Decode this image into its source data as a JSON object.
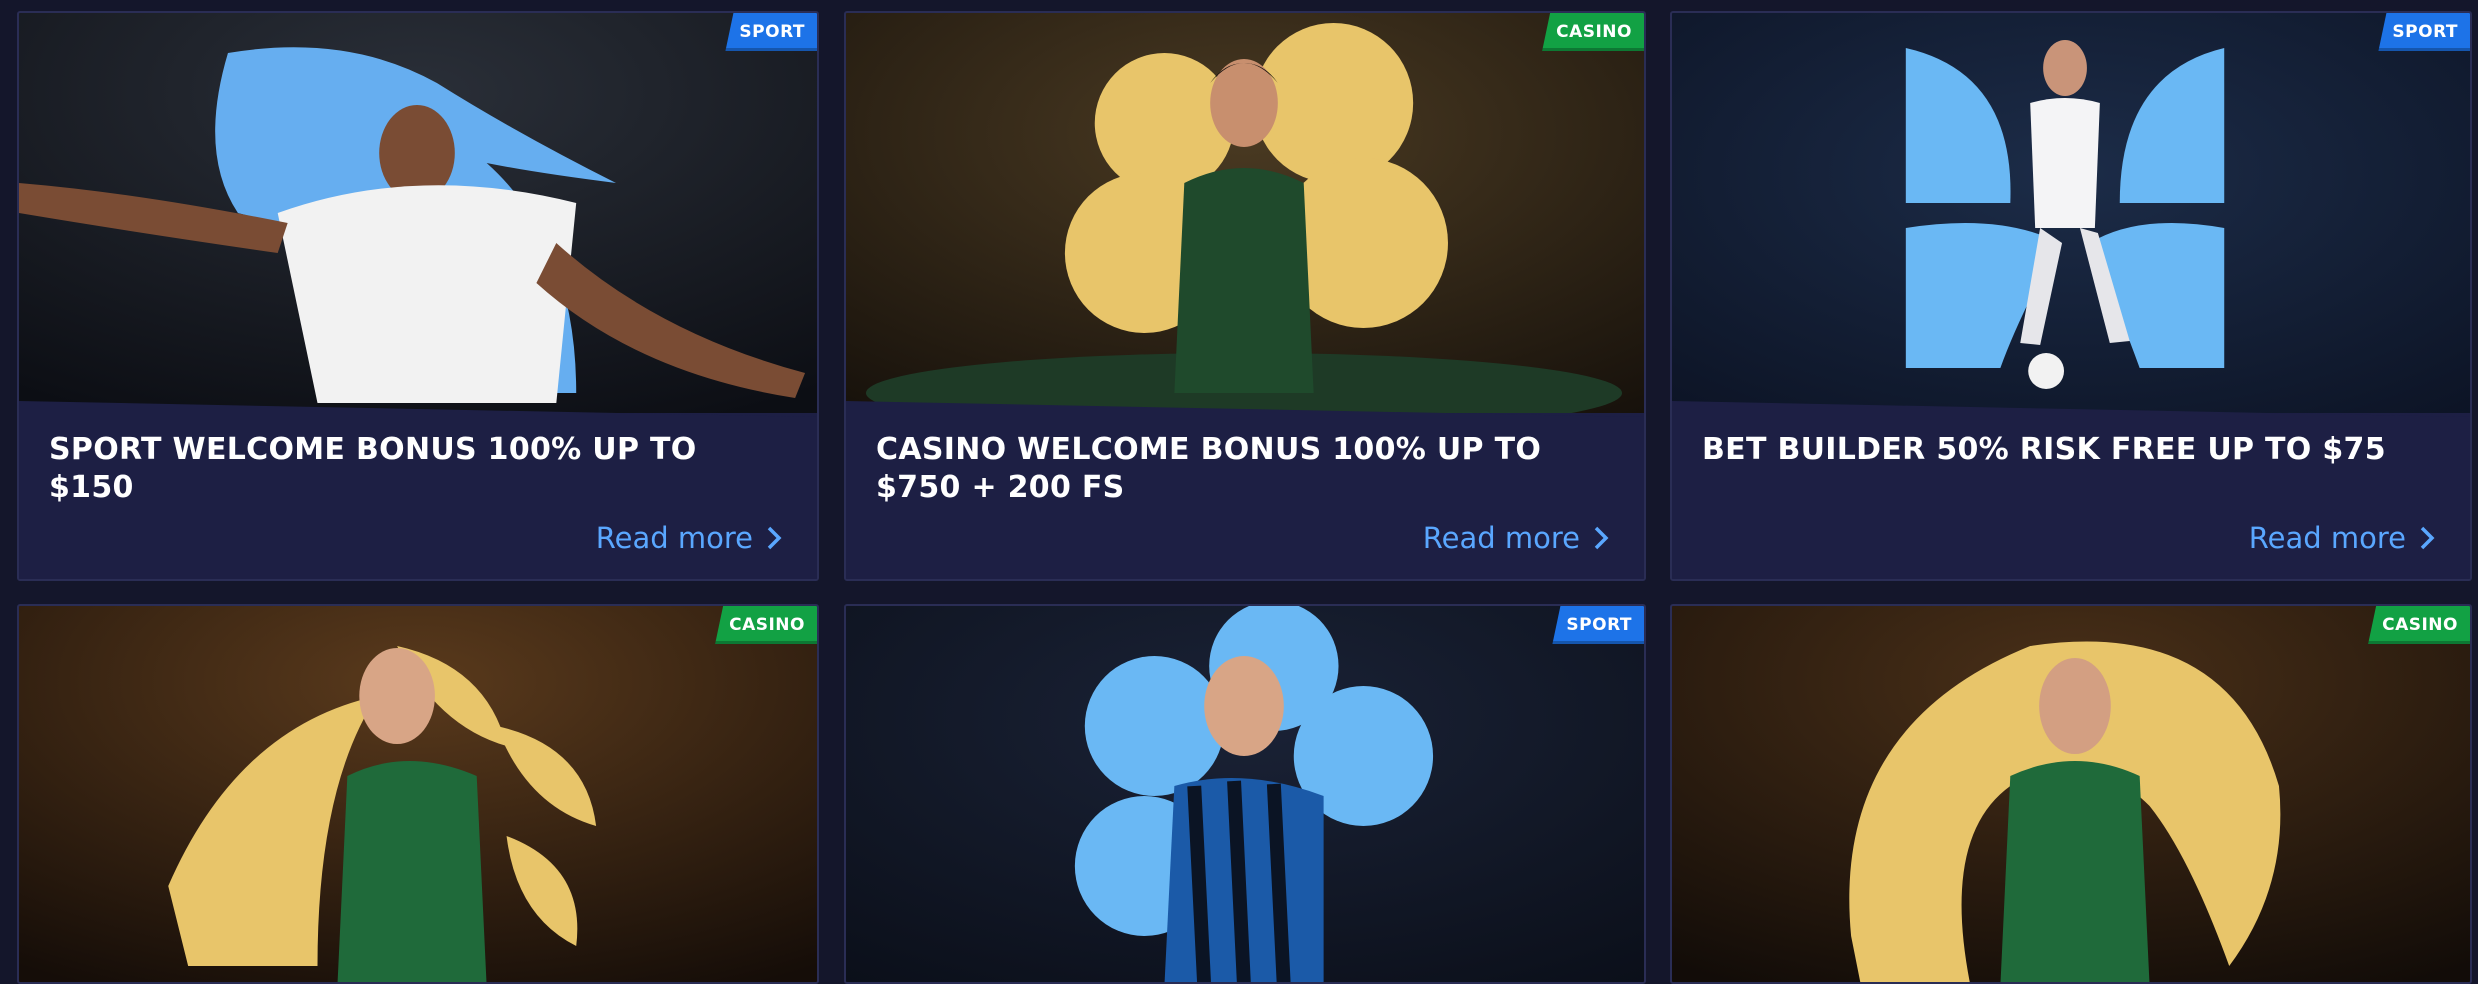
{
  "colors": {
    "page_bg": "#14162b",
    "card_bg": "#1d1f44",
    "link": "#5aa7ff",
    "sport": "#1d73e8",
    "casino": "#12a144",
    "gold": "#e8c56a",
    "sky": "#6ab8f4"
  },
  "cards": [
    {
      "badge": "SPORT",
      "theme": "sport",
      "title": "SPORT WELCOME BONUS 100% UP TO $150",
      "link": "Read more",
      "image": "football-player-celebrating"
    },
    {
      "badge": "CASINO",
      "theme": "casino",
      "title": "CASINO WELCOME BONUS 100% UP TO $750 + 200 FS",
      "link": "Read more",
      "image": "casino-dealer-at-table"
    },
    {
      "badge": "SPORT",
      "theme": "sport",
      "title": "BET BUILDER 50% RISK FREE UP TO $75",
      "link": "Read more",
      "image": "footballer-number-5-with-ball"
    },
    {
      "badge": "CASINO",
      "theme": "casino",
      "image": "woman-in-green-dress-pointing"
    },
    {
      "badge": "SPORT",
      "theme": "sport",
      "image": "footballer-in-striped-shirt"
    },
    {
      "badge": "CASINO",
      "theme": "casino",
      "image": "woman-in-green-dress-smiling"
    }
  ]
}
